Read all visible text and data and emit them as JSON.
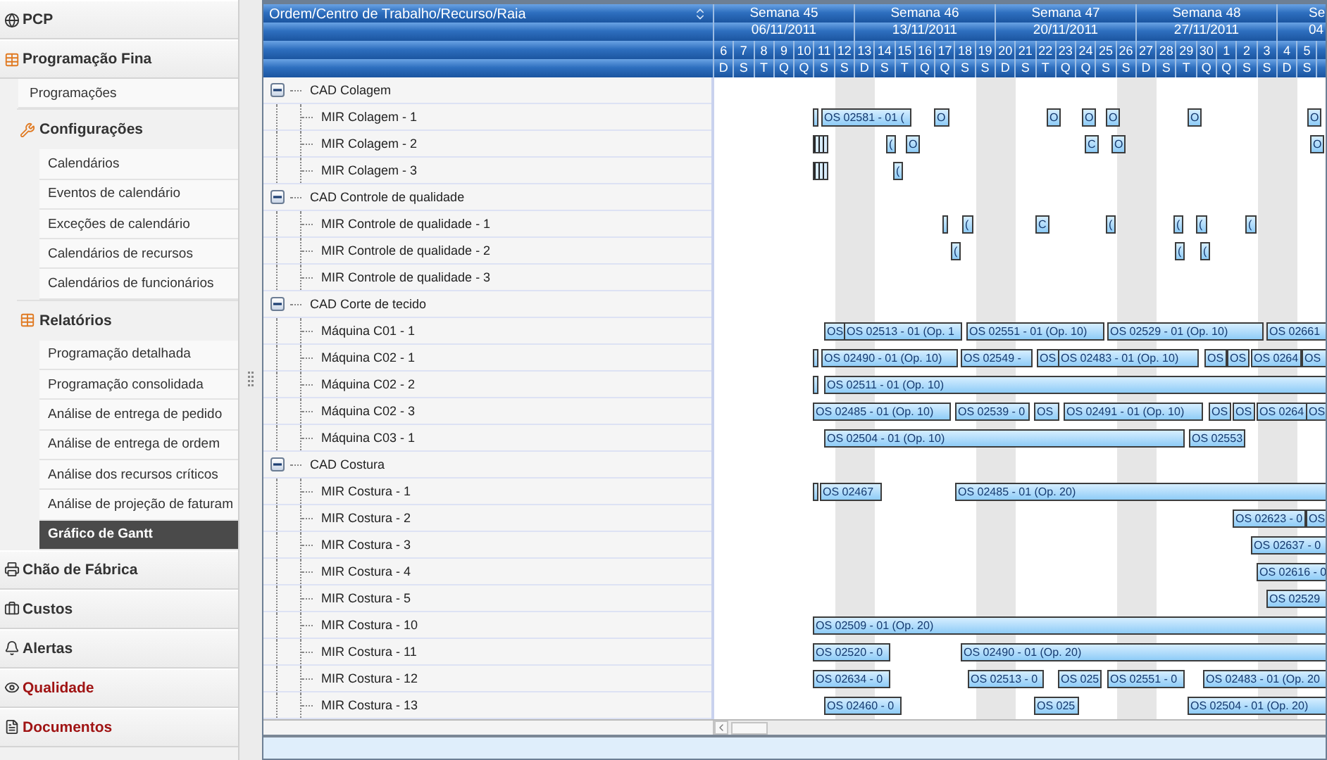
{
  "sidebar": {
    "sections": [
      {
        "label": "PCP",
        "color": "#333333"
      },
      {
        "label": "Programação Fina",
        "color": "#333333",
        "expanded": true,
        "children": [
          {
            "label": "Programações",
            "selected": false
          },
          {
            "label": "Configurações",
            "children": [
              {
                "label": "Calendários",
                "selected": false
              },
              {
                "label": "Eventos de calendário",
                "selected": false
              },
              {
                "label": "Exceções de calendário",
                "selected": false
              },
              {
                "label": "Calendários de recursos",
                "selected": false
              },
              {
                "label": "Calendários de funcionários",
                "selected": false
              }
            ]
          },
          {
            "label": "Relatórios",
            "children": [
              {
                "label": "Programação detalhada",
                "selected": false
              },
              {
                "label": "Programação consolidada",
                "selected": false
              },
              {
                "label": "Análise de entrega de pedido",
                "selected": false
              },
              {
                "label": "Análise de entrega de ordem",
                "selected": false
              },
              {
                "label": "Análise dos recursos críticos",
                "selected": false
              },
              {
                "label": "Análise de projeção de faturam",
                "selected": false
              },
              {
                "label": "Gráfico de Gantt",
                "selected": true
              }
            ]
          }
        ]
      },
      {
        "label": "Chão de Fábrica",
        "color": "#333333"
      },
      {
        "label": "Custos",
        "color": "#333333"
      },
      {
        "label": "Alertas",
        "color": "#333333"
      },
      {
        "label": "Qualidade",
        "color": "#a01414"
      },
      {
        "label": "Documentos",
        "color": "#a01414"
      }
    ]
  },
  "gantt": {
    "tree_header": "Ordem/Centro de Trabalho/Recurso/Raia",
    "weeks": [
      {
        "label": "Semana 45",
        "date": "06/11/2011"
      },
      {
        "label": "Semana 46",
        "date": "13/11/2011"
      },
      {
        "label": "Semana 47",
        "date": "20/11/2011"
      },
      {
        "label": "Semana 48",
        "date": "27/11/2011"
      },
      {
        "label": "Se",
        "date": "04"
      }
    ],
    "days": [
      {
        "number": "6",
        "letter": "D",
        "weekend": false
      },
      {
        "number": "7",
        "letter": "S",
        "weekend": false
      },
      {
        "number": "8",
        "letter": "T",
        "weekend": false
      },
      {
        "number": "9",
        "letter": "Q",
        "weekend": false
      },
      {
        "number": "10",
        "letter": "Q",
        "weekend": false
      },
      {
        "number": "11",
        "letter": "S",
        "weekend": false
      },
      {
        "number": "12",
        "letter": "S",
        "weekend": true
      },
      {
        "number": "13",
        "letter": "D",
        "weekend": true
      },
      {
        "number": "14",
        "letter": "S",
        "weekend": false
      },
      {
        "number": "15",
        "letter": "T",
        "weekend": false
      },
      {
        "number": "16",
        "letter": "Q",
        "weekend": false
      },
      {
        "number": "17",
        "letter": "Q",
        "weekend": false
      },
      {
        "number": "18",
        "letter": "S",
        "weekend": false
      },
      {
        "number": "19",
        "letter": "S",
        "weekend": true
      },
      {
        "number": "20",
        "letter": "D",
        "weekend": true
      },
      {
        "number": "21",
        "letter": "S",
        "weekend": false
      },
      {
        "number": "22",
        "letter": "T",
        "weekend": false
      },
      {
        "number": "23",
        "letter": "Q",
        "weekend": false
      },
      {
        "number": "24",
        "letter": "Q",
        "weekend": false
      },
      {
        "number": "25",
        "letter": "S",
        "weekend": false
      },
      {
        "number": "26",
        "letter": "S",
        "weekend": true
      },
      {
        "number": "27",
        "letter": "D",
        "weekend": true
      },
      {
        "number": "28",
        "letter": "S",
        "weekend": false
      },
      {
        "number": "29",
        "letter": "T",
        "weekend": false
      },
      {
        "number": "30",
        "letter": "Q",
        "weekend": false
      },
      {
        "number": "1",
        "letter": "Q",
        "weekend": false
      },
      {
        "number": "2",
        "letter": "S",
        "weekend": false
      },
      {
        "number": "3",
        "letter": "S",
        "weekend": true
      },
      {
        "number": "4",
        "letter": "D",
        "weekend": true
      },
      {
        "number": "5",
        "letter": "S",
        "weekend": false
      }
    ],
    "groups": [
      {
        "label": "CAD Colagem",
        "expanded": true,
        "children": [
          {
            "label": "MIR Colagem - 1",
            "bars": [
              {
                "kind": "bar"
              },
              {
                "kind": "bar",
                "label": "OS 02581 - 01 ("
              },
              {
                "kind": "bar",
                "label": "O"
              },
              {
                "kind": "bar",
                "label": "O"
              },
              {
                "kind": "bar",
                "label": "O"
              },
              {
                "kind": "bar",
                "label": "O"
              },
              {
                "kind": "bar",
                "label": "O"
              },
              {
                "kind": "bar",
                "label": "O"
              }
            ]
          },
          {
            "label": "MIR Colagem - 2",
            "bars": [
              {
                "kind": "cluster"
              },
              {
                "kind": "bar",
                "label": "("
              },
              {
                "kind": "bar",
                "label": "O"
              },
              {
                "kind": "bar",
                "label": "C"
              },
              {
                "kind": "bar",
                "label": "O"
              },
              {
                "kind": "bar",
                "label": "O"
              }
            ]
          },
          {
            "label": "MIR Colagem - 3",
            "bars": [
              {
                "kind": "cluster"
              },
              {
                "kind": "bar",
                "label": "("
              }
            ]
          }
        ]
      },
      {
        "label": "CAD Controle de qualidade",
        "expanded": true,
        "children": [
          {
            "label": "MIR Controle de qualidade - 1",
            "bars": [
              {
                "kind": "bar"
              },
              {
                "kind": "bar",
                "label": "("
              },
              {
                "kind": "bar",
                "label": "C"
              },
              {
                "kind": "bar",
                "label": "("
              },
              {
                "kind": "bar",
                "label": "("
              },
              {
                "kind": "bar",
                "label": "("
              },
              {
                "kind": "bar",
                "label": "("
              }
            ]
          },
          {
            "label": "MIR Controle de qualidade - 2",
            "bars": [
              {
                "kind": "bar",
                "label": "("
              },
              {
                "kind": "bar",
                "label": "("
              },
              {
                "kind": "bar",
                "label": "("
              }
            ]
          },
          {
            "label": "MIR Controle de qualidade - 3"
          }
        ]
      },
      {
        "label": "CAD Corte de tecido",
        "expanded": true,
        "children": [
          {
            "label": "Máquina C01 - 1",
            "bars": [
              {
                "kind": "bar",
                "label": "OS"
              },
              {
                "kind": "bar",
                "label": "OS 02513 - 01 (Op. 1"
              },
              {
                "kind": "bar",
                "label": "OS 02551 - 01 (Op. 10)"
              },
              {
                "kind": "bar",
                "label": "OS 02529 - 01 (Op. 10)"
              },
              {
                "kind": "bar",
                "label": "OS 02661"
              }
            ]
          },
          {
            "label": "Máquina C02 - 1",
            "bars": [
              {
                "kind": "bar"
              },
              {
                "kind": "bar",
                "label": "OS 02490 - 01 (Op. 10)"
              },
              {
                "kind": "bar",
                "label": "OS 02549 -"
              },
              {
                "kind": "bar",
                "label": "OS"
              },
              {
                "kind": "bar",
                "label": "OS 02483 - 01 (Op. 10)"
              },
              {
                "kind": "bar",
                "label": "OS"
              },
              {
                "kind": "bar",
                "label": "OS"
              },
              {
                "kind": "bar",
                "label": "OS 0264"
              },
              {
                "kind": "bar",
                "label": "OS"
              }
            ]
          },
          {
            "label": "Máquina C02 - 2",
            "bars": [
              {
                "kind": "bar"
              },
              {
                "kind": "bar",
                "label": "OS 02511 - 01 (Op. 10)"
              }
            ]
          },
          {
            "label": "Máquina C02 - 3",
            "bars": [
              {
                "kind": "bar",
                "label": "OS 02485 - 01 (Op. 10)"
              },
              {
                "kind": "bar",
                "label": "OS 02539 - 0"
              },
              {
                "kind": "bar",
                "label": "OS"
              },
              {
                "kind": "bar",
                "label": "OS 02491 - 01 (Op. 10)"
              },
              {
                "kind": "bar",
                "label": "OS"
              },
              {
                "kind": "bar",
                "label": "OS"
              },
              {
                "kind": "bar",
                "label": "OS 0264"
              },
              {
                "kind": "bar",
                "label": "OS"
              }
            ]
          },
          {
            "label": "Máquina C03 - 1",
            "bars": [
              {
                "kind": "bar",
                "label": "OS 02504 - 01 (Op. 10)"
              },
              {
                "kind": "bar",
                "label": "OS 02553"
              }
            ]
          }
        ]
      },
      {
        "label": "CAD Costura",
        "expanded": true,
        "children": [
          {
            "label": "MIR Costura - 1",
            "bars": [
              {
                "kind": "bar"
              },
              {
                "kind": "bar",
                "label": "OS 02467"
              },
              {
                "kind": "bar",
                "label": "OS 02485 - 01 (Op. 20)"
              }
            ]
          },
          {
            "label": "MIR Costura - 2",
            "bars": [
              {
                "kind": "bar",
                "label": "OS 02623 - 0"
              },
              {
                "kind": "bar",
                "label": "OS"
              }
            ]
          },
          {
            "label": "MIR Costura - 3",
            "bars": [
              {
                "kind": "bar",
                "label": "OS 02637 - 0"
              }
            ]
          },
          {
            "label": "MIR Costura - 4",
            "bars": [
              {
                "kind": "bar",
                "label": "OS 02616 - 0"
              }
            ]
          },
          {
            "label": "MIR Costura - 5",
            "bars": [
              {
                "kind": "bar",
                "label": "OS 02529"
              }
            ]
          },
          {
            "label": "MIR Costura - 10",
            "bars": [
              {
                "kind": "bar",
                "label": "OS 02509 - 01 (Op. 20)"
              }
            ]
          },
          {
            "label": "MIR Costura - 11",
            "bars": [
              {
                "kind": "bar",
                "label": "OS 02520 - 0"
              },
              {
                "kind": "bar",
                "label": "OS 02490 - 01 (Op. 20)"
              }
            ]
          },
          {
            "label": "MIR Costura - 12",
            "bars": [
              {
                "kind": "bar",
                "label": "OS 02634 - 0"
              },
              {
                "kind": "bar",
                "label": "OS 02513 - 0"
              },
              {
                "kind": "bar",
                "label": "OS 025"
              },
              {
                "kind": "bar",
                "label": "OS 02551 - 0"
              },
              {
                "kind": "bar",
                "label": "OS 02483 - 01 (Op. 20"
              }
            ]
          },
          {
            "label": "MIR Costura - 13",
            "bars": [
              {
                "kind": "bar",
                "label": "OS 02460 - 0"
              },
              {
                "kind": "bar",
                "label": "OS 025"
              },
              {
                "kind": "bar",
                "label": "OS 02504 - 01 (Op. 20)"
              }
            ]
          }
        ]
      }
    ]
  }
}
